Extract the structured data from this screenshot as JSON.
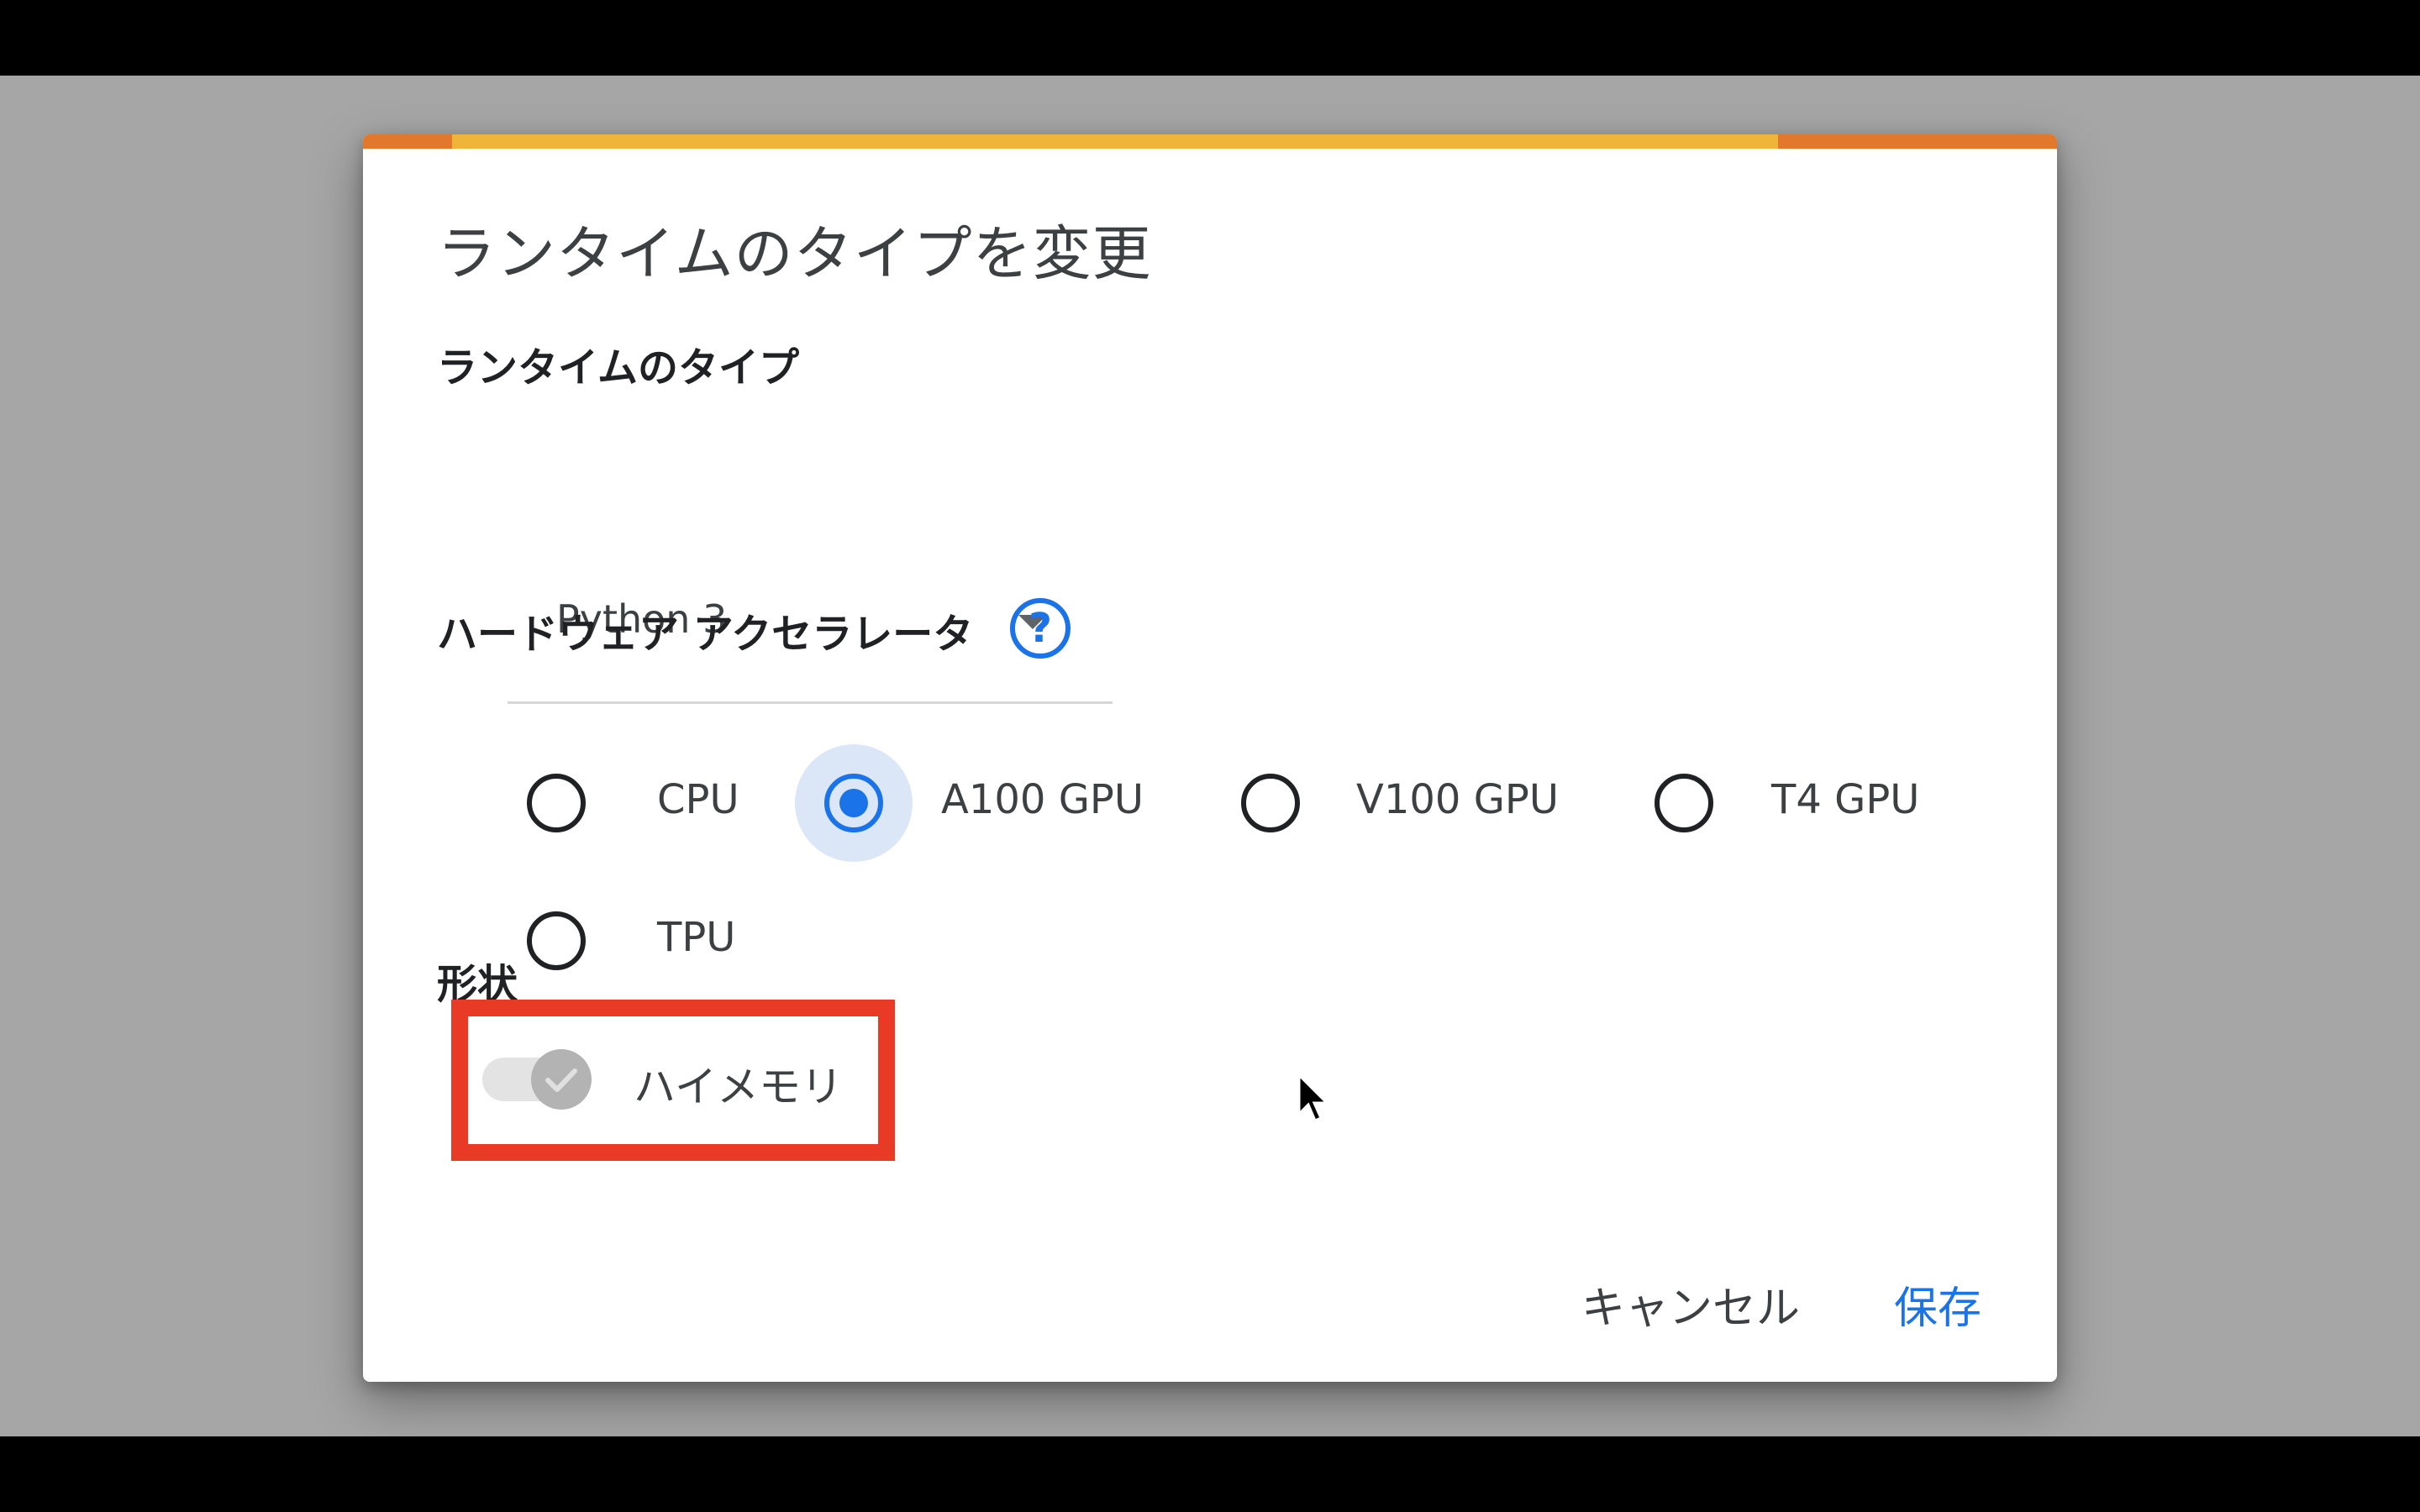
{
  "dialog": {
    "title": "ランタイムのタイプを変更",
    "runtime_type": {
      "label": "ランタイムのタイプ",
      "selected": "Python 3"
    },
    "hardware_accelerator": {
      "label": "ハードウェア アクセラレータ",
      "help_icon": "?",
      "options": [
        {
          "label": "CPU",
          "selected": false
        },
        {
          "label": "A100 GPU",
          "selected": true
        },
        {
          "label": "V100 GPU",
          "selected": false
        },
        {
          "label": "T4 GPU",
          "selected": false
        },
        {
          "label": "TPU",
          "selected": false
        }
      ]
    },
    "shape": {
      "label": "形状",
      "high_memory": {
        "label": "ハイメモリ",
        "enabled": true,
        "disabled_state": true
      }
    },
    "actions": {
      "cancel_label": "キャンセル",
      "save_label": "保存"
    }
  },
  "colors": {
    "accent_orange": "#e2782c",
    "accent_yellow": "#efb53a",
    "primary_blue": "#1a73e8",
    "highlight_red": "#e83a24",
    "scrim": "#a6a6a6"
  },
  "icons": [
    "help-icon",
    "dropdown-arrow-icon",
    "check-icon",
    "mouse-cursor-icon"
  ]
}
